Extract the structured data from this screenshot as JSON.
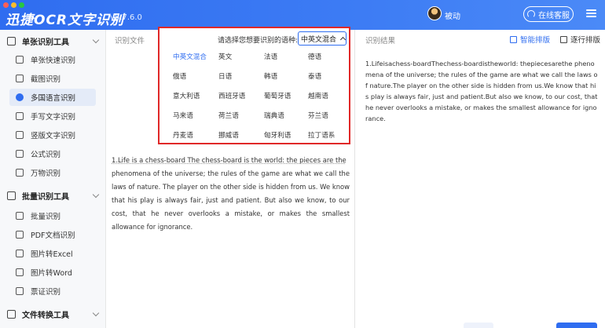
{
  "app": {
    "title": "迅捷OCR文字识别",
    "version": "v8.7.6.0",
    "user_name": "被动",
    "support_label": "在线客服"
  },
  "sidebar": {
    "groups": [
      {
        "label": "单张识别工具",
        "items": [
          "单张快速识别",
          "截图识别",
          "多国语言识别",
          "手写文字识别",
          "竖版文字识别",
          "公式识别",
          "万物识别"
        ]
      },
      {
        "label": "批量识别工具",
        "items": [
          "批量识别",
          "PDF文档识别",
          "图片转Excel",
          "图片转Word",
          "票证识别"
        ]
      },
      {
        "label": "文件转换工具",
        "items": []
      }
    ],
    "active_item": "多国语言识别"
  },
  "center": {
    "panel_label": "识别文件",
    "ocr_text_first": "1.Life is a chess-board The chess-board is the world: the pieces are the",
    "ocr_text_rest": "phenomena of the universe; the rules of the game are what we call the laws of nature. The player on the other side is hidden from us. We know that his play is always fair, just and patient. But also we know, to our cost, that he never overlooks a mistake, or makes the smallest allowance for ignorance."
  },
  "language_picker": {
    "prompt": "请选择您想要识别的语种:",
    "selected": "中英文混合",
    "options": [
      [
        "中英文混合",
        "英文",
        "法语",
        "德语"
      ],
      [
        "俄语",
        "日语",
        "韩语",
        "泰语"
      ],
      [
        "意大利语",
        "西班牙语",
        "葡萄牙语",
        "越南语"
      ],
      [
        "马来语",
        "荷兰语",
        "瑞典语",
        "芬兰语"
      ],
      [
        "丹麦语",
        "挪威语",
        "匈牙利语",
        "拉丁语系"
      ]
    ]
  },
  "right": {
    "panel_label": "识别结果",
    "smart_layout_label": "智能排版",
    "line_layout_label": "逐行排版",
    "result_text": "1.Lifeisachess-boardThechess-boardistheworld: thepiecesarethe phenomena of the universe; the rules of the game are what we call the laws of nature.The player on the other side is hidden from us.We know that his play is always fair, just and patient.But also we know, to our cost, that he never overlooks a mistake, or makes the smallest allowance for ignorance."
  },
  "colors": {
    "header_blue": "#2f6df0",
    "accent_blue": "#2f6df0",
    "highlight_red": "#e02828",
    "active_nav_bg": "#e4ebf8"
  },
  "icons": [
    "window-close-icon",
    "window-minimize-icon",
    "window-maximize-icon",
    "headset-icon",
    "hamburger-menu-icon",
    "chevron-up-icon"
  ]
}
